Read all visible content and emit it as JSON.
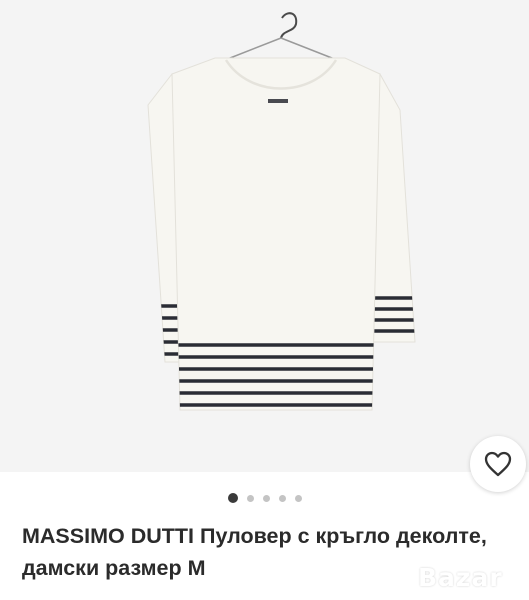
{
  "product": {
    "brand": "MASSIMO DUTTI",
    "title_rest": "Пуловер с кръгло деколте, дамски размер М",
    "image": "product-photo-white-striped-sweater-on-hanger"
  },
  "gallery": {
    "dot_count": 5,
    "active_index": 0
  },
  "favorite": {
    "icon": "heart-icon"
  },
  "watermark": {
    "text": "Bazar"
  },
  "colors": {
    "photo_bg": "#f4f4f4",
    "sweater": "#f7f6f1",
    "stripe": "#2a2c34",
    "active_dot": "#3a3a3a",
    "inactive_dot": "#c4c4c4"
  }
}
